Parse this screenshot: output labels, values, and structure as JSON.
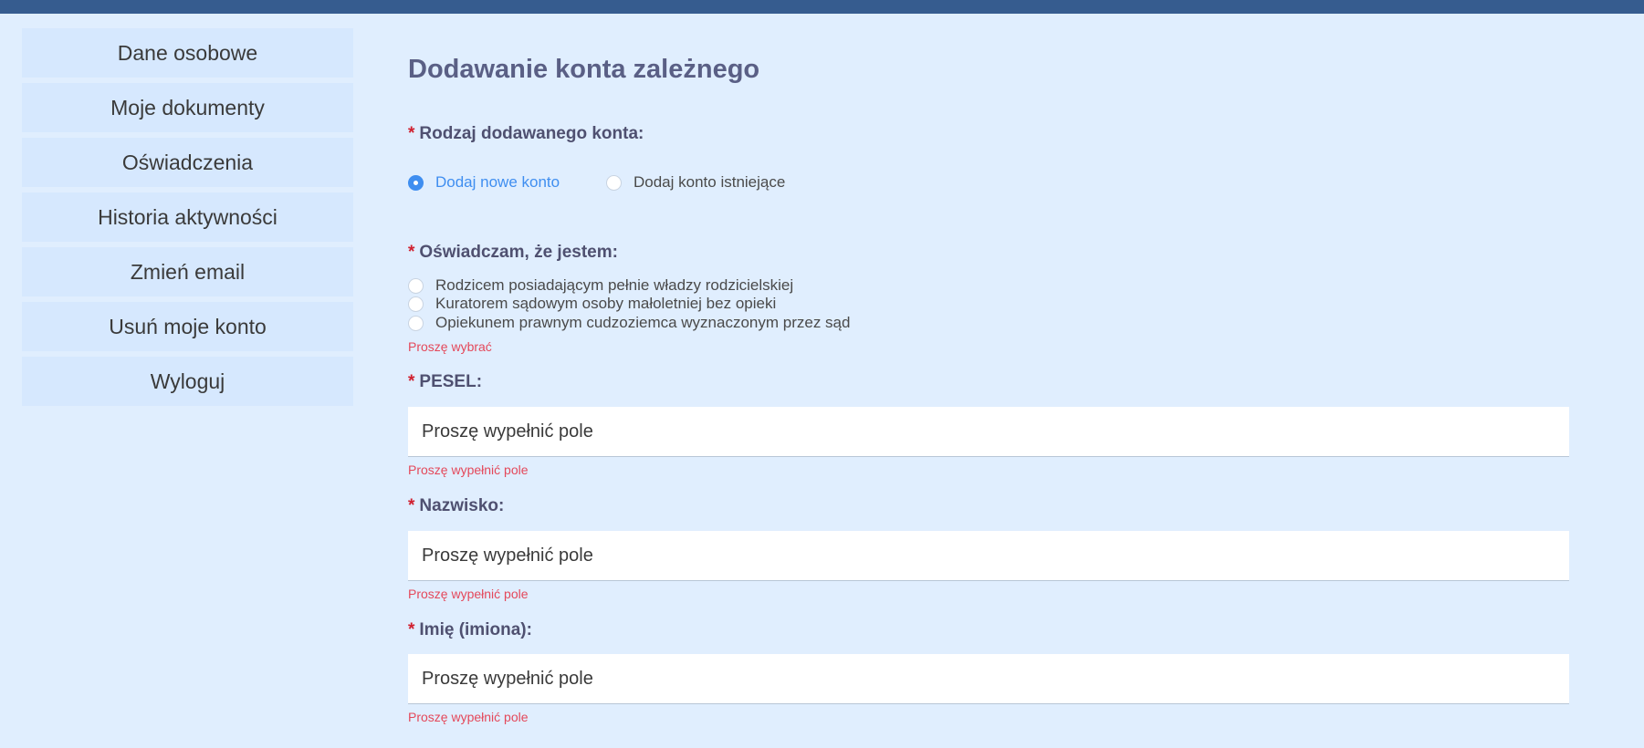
{
  "sidebar": {
    "items": [
      {
        "label": "Dane osobowe"
      },
      {
        "label": "Moje dokumenty"
      },
      {
        "label": "Oświadczenia"
      },
      {
        "label": "Historia aktywności"
      },
      {
        "label": "Zmień email"
      },
      {
        "label": "Usuń moje konto"
      },
      {
        "label": "Wyloguj"
      }
    ]
  },
  "form": {
    "title": "Dodawanie konta zależnego",
    "required_marker": "*",
    "account_type": {
      "label": "Rodzaj dodawanego konta:",
      "options": [
        {
          "label": "Dodaj nowe konto",
          "selected": true
        },
        {
          "label": "Dodaj konto istniejące",
          "selected": false
        }
      ]
    },
    "declaration": {
      "label": "Oświadczam, że jestem:",
      "options": [
        {
          "label": "Rodzicem posiadającym pełnie władzy rodzicielskiej"
        },
        {
          "label": "Kuratorem sądowym osoby małoletniej bez opieki"
        },
        {
          "label": "Opiekunem prawnym cudzoziemca wyznaczonym przez sąd"
        }
      ],
      "error": "Proszę wybrać"
    },
    "pesel": {
      "label": "PESEL:",
      "placeholder": "Proszę wypełnić pole",
      "error": "Proszę wypełnić pole"
    },
    "surname": {
      "label": "Nazwisko:",
      "placeholder": "Proszę wypełnić pole",
      "error": "Proszę wypełnić pole"
    },
    "firstname": {
      "label": "Imię (imiona):",
      "placeholder": "Proszę wypełnić pole",
      "error": "Proszę wypełnić pole"
    }
  },
  "colors": {
    "background": "#e0eefe",
    "topbar": "#365c8f",
    "accent": "#3f8ef0",
    "error": "#e4485a",
    "required": "#d0202f"
  }
}
